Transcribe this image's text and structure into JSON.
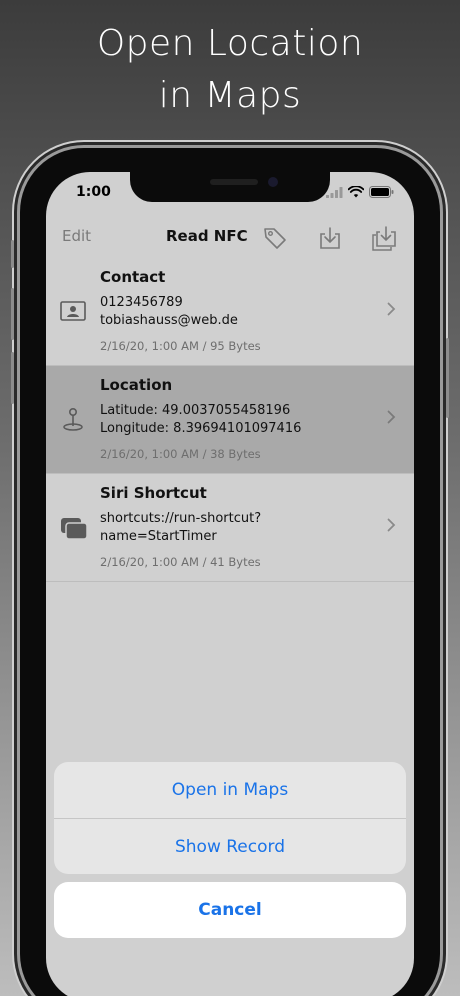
{
  "headline": {
    "line1": "Open Location",
    "line2": "in Maps"
  },
  "status_bar": {
    "time": "1:00"
  },
  "nav": {
    "edit": "Edit",
    "title": "Read NFC"
  },
  "records": [
    {
      "title": "Contact",
      "line1": "0123456789",
      "line2": "tobiashauss@web.de",
      "meta": "2/16/20, 1:00 AM / 95 Bytes",
      "icon": "contact-card-icon"
    },
    {
      "title": "Location",
      "line1": "Latitude: 49.0037055458196",
      "line2": "Longitude: 8.39694101097416",
      "meta": "2/16/20, 1:00 AM / 38 Bytes",
      "icon": "location-pin-icon"
    },
    {
      "title": "Siri Shortcut",
      "line1": "shortcuts://run-shortcut?",
      "line2": "name=StartTimer",
      "meta": "2/16/20, 1:00 AM / 41 Bytes",
      "icon": "shortcut-icon"
    }
  ],
  "action_sheet": {
    "open_in_maps": "Open in Maps",
    "show_record": "Show Record",
    "cancel": "Cancel"
  },
  "colors": {
    "accent": "#1a73e8",
    "selected_row": "#a9a9a9",
    "background": "#d0d0d0"
  }
}
